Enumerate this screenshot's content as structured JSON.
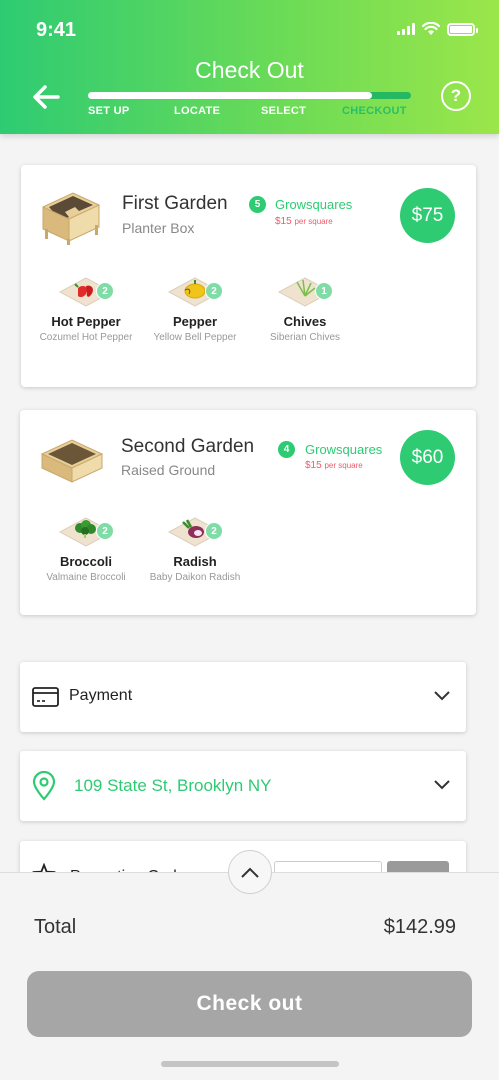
{
  "status_bar": {
    "time": "9:41"
  },
  "header": {
    "title": "Check Out",
    "help_symbol": "?",
    "progress": 0.88,
    "steps": [
      {
        "label": "SET UP",
        "active": true
      },
      {
        "label": "LOCATE",
        "active": true
      },
      {
        "label": "SELECT",
        "active": true
      },
      {
        "label": "CHECKOUT",
        "active": false
      }
    ]
  },
  "gardens": [
    {
      "name": "First Garden",
      "type": "Planter Box",
      "growsquares_count": "5",
      "growsquares_label": "Growsquares",
      "price_per": "$15",
      "price_per_unit": "per square",
      "total": "$75",
      "plants": [
        {
          "name": "Hot Pepper",
          "variety": "Cozumel Hot Pepper",
          "count": "2",
          "icon": "hot-pepper-icon"
        },
        {
          "name": "Pepper",
          "variety": "Yellow Bell Pepper",
          "count": "2",
          "icon": "pepper-icon"
        },
        {
          "name": "Chives",
          "variety": "Siberian Chives",
          "count": "1",
          "icon": "chives-icon"
        }
      ]
    },
    {
      "name": "Second Garden",
      "type": "Raised Ground",
      "growsquares_count": "4",
      "growsquares_label": "Growsquares",
      "price_per": "$15",
      "price_per_unit": "per square",
      "total": "$60",
      "plants": [
        {
          "name": "Broccoli",
          "variety": "Valmaine Broccoli",
          "count": "2",
          "icon": "broccoli-icon"
        },
        {
          "name": "Radish",
          "variety": "Baby Daikon Radish",
          "count": "2",
          "icon": "radish-icon"
        }
      ]
    }
  ],
  "payment": {
    "label": "Payment"
  },
  "address": {
    "label": "109 State St, Brooklyn NY"
  },
  "promo": {
    "label": "Promotion Code"
  },
  "footer": {
    "total_label": "Total",
    "total_value": "$142.99",
    "checkout_label": "Check out"
  },
  "colors": {
    "accent": "#2ecb73",
    "accent_light": "#9be64a",
    "price_red": "#f05a6a",
    "disabled": "#a6a6a6"
  }
}
